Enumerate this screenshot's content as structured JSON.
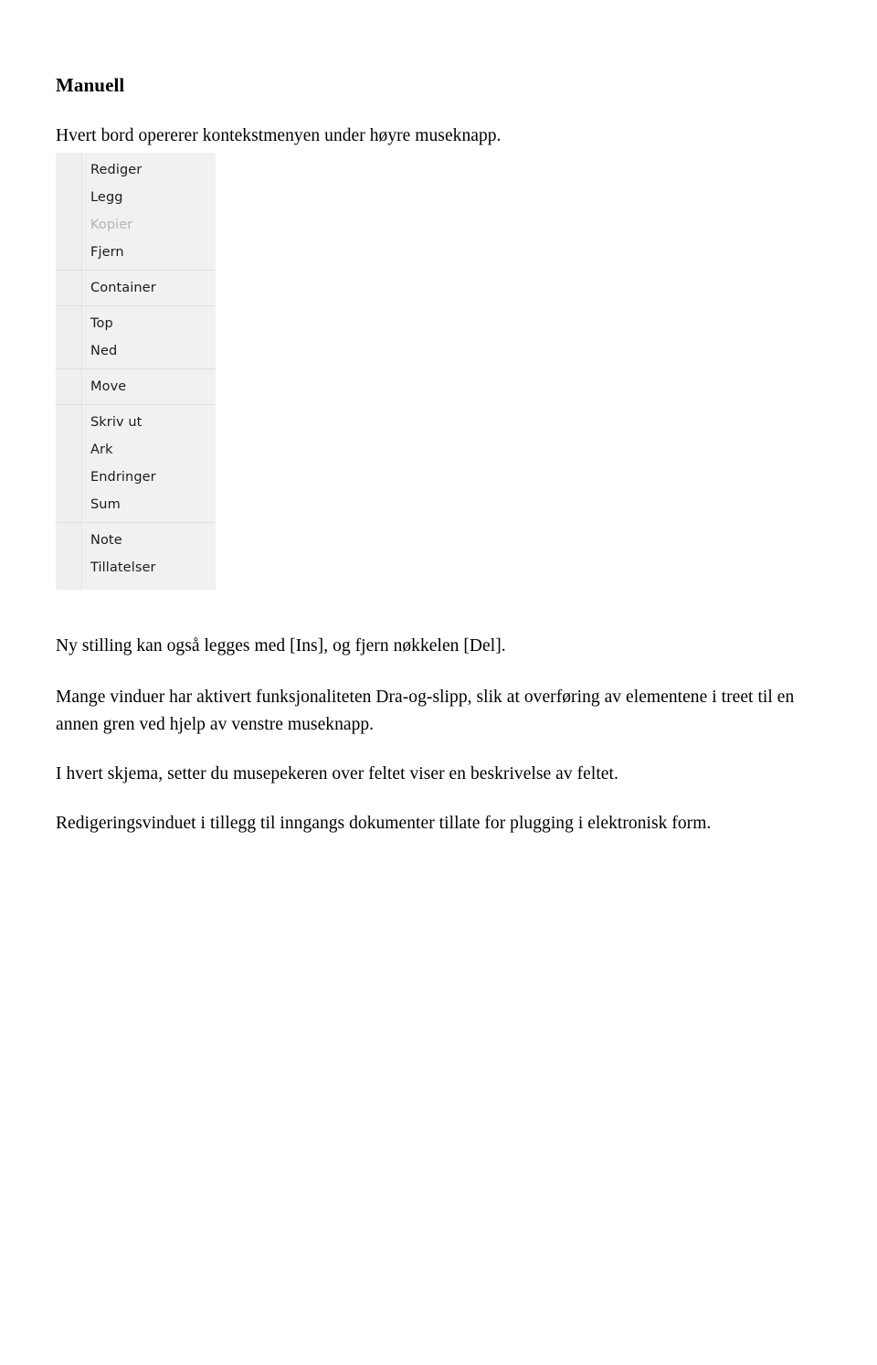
{
  "document": {
    "heading": "Manuell",
    "paragraphs": {
      "intro": "Hvert bord opererer kontekstmenyen under høyre museknapp.",
      "ins_del": "Ny stilling kan også legges med [Ins], og fjern nøkkelen [Del].",
      "dragdrop": "Mange vinduer har aktivert funksjonaliteten Dra-og-slipp, slik at overføring av elementene i treet til en annen gren ved hjelp av venstre museknapp.",
      "tooltip": "I hvert skjema, setter du musepekeren over feltet viser en beskrivelse av feltet.",
      "editwindow": "Redigeringsvinduet i tillegg til inngangs dokumenter tillate for plugging i elektronisk form."
    }
  },
  "context_menu": {
    "groups": [
      {
        "items": [
          {
            "label": "Rediger",
            "disabled": false
          },
          {
            "label": "Legg",
            "disabled": false
          },
          {
            "label": "Kopier",
            "disabled": true
          },
          {
            "label": "Fjern",
            "disabled": false
          }
        ]
      },
      {
        "items": [
          {
            "label": "Container",
            "disabled": false
          }
        ]
      },
      {
        "items": [
          {
            "label": "Top",
            "disabled": false
          },
          {
            "label": "Ned",
            "disabled": false
          }
        ]
      },
      {
        "items": [
          {
            "label": "Move",
            "disabled": false
          }
        ]
      },
      {
        "items": [
          {
            "label": "Skriv ut",
            "disabled": false
          },
          {
            "label": "Ark",
            "disabled": false
          },
          {
            "label": "Endringer",
            "disabled": false
          },
          {
            "label": "Sum",
            "disabled": false
          }
        ]
      },
      {
        "items": [
          {
            "label": "Note",
            "disabled": false
          },
          {
            "label": "Tillatelser",
            "disabled": false
          }
        ]
      }
    ],
    "colors": {
      "background": "#f1f1f1",
      "gutter": "#efefef",
      "separator": "#e0e0e0",
      "text": "#1b1b1b",
      "text_disabled": "#b4b4b4"
    }
  }
}
